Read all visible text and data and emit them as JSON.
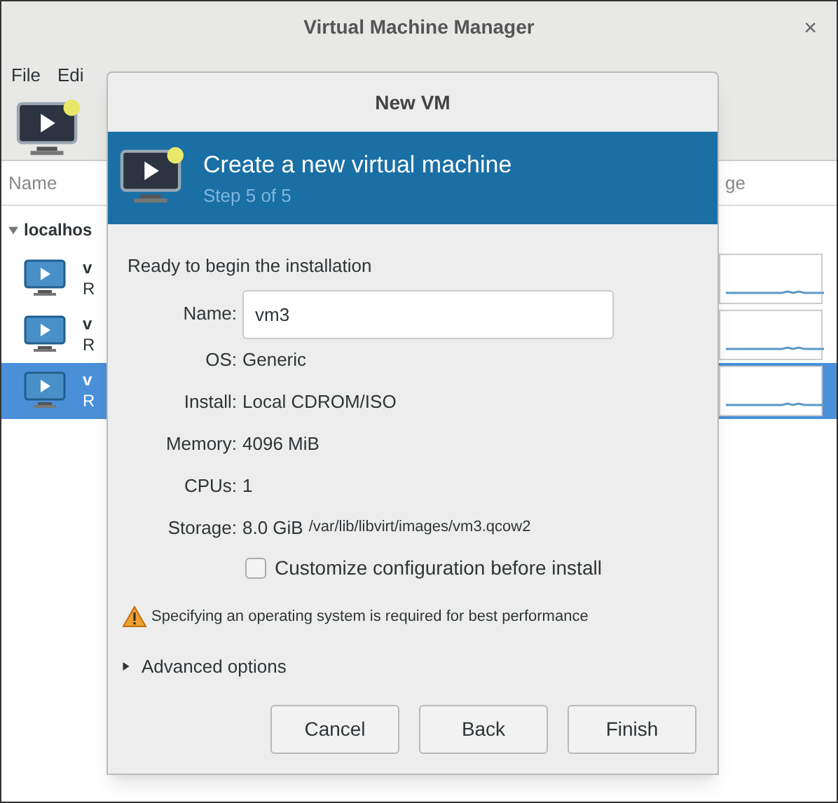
{
  "window": {
    "title": "Virtual Machine Manager",
    "close": "×"
  },
  "menu": [
    "File",
    "Edi"
  ],
  "columns": [
    "Name",
    "ge"
  ],
  "tree": {
    "label": "localhos",
    "expanded": true,
    "children": [
      {
        "name": "v",
        "status": "R",
        "selected": false
      },
      {
        "name": "v",
        "status": "R",
        "selected": false
      },
      {
        "name": "v",
        "status": "R",
        "selected": true
      }
    ]
  },
  "dialog": {
    "title": "New VM",
    "header": {
      "title": "Create a new virtual machine",
      "subtitle": "Step 5 of 5"
    },
    "heading": "Ready to begin the installation",
    "name_field": {
      "label": "Name:",
      "value": "vm3"
    },
    "details": [
      {
        "label": "OS:",
        "value": "Generic"
      },
      {
        "label": "Install:",
        "value": "Local CDROM/ISO"
      },
      {
        "label": "Memory:",
        "value": "4096 MiB"
      },
      {
        "label": "CPUs:",
        "value": "1"
      },
      {
        "label": "Storage:",
        "value": "8.0 GiB",
        "path": "/var/lib/libvirt/images/vm3.qcow2"
      }
    ],
    "customize": {
      "label": "Customize configuration before install",
      "checked": false
    },
    "warning": "Specifying an operating system is required for best performance",
    "advanced": {
      "label": "Advanced options",
      "expanded": false
    },
    "buttons": [
      "Cancel",
      "Back",
      "Finish"
    ]
  }
}
